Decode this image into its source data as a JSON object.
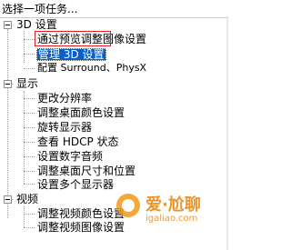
{
  "header": {
    "title": "选择一项任务..."
  },
  "tree": {
    "groups": [
      {
        "label": "3D 设置",
        "items": [
          {
            "label": "通过预览调整图像设置"
          },
          {
            "label": "管理 3D 设置"
          },
          {
            "label": "配置 Surround、PhysX"
          }
        ]
      },
      {
        "label": "显示",
        "items": [
          {
            "label": "更改分辨率"
          },
          {
            "label": "调整桌面颜色设置"
          },
          {
            "label": "旋转显示器"
          },
          {
            "label": "查看 HDCP 状态"
          },
          {
            "label": "设置数字音频"
          },
          {
            "label": "调整桌面尺寸和位置"
          },
          {
            "label": "设置多个显示器"
          }
        ]
      },
      {
        "label": "视频",
        "items": [
          {
            "label": "调整视频颜色设置"
          },
          {
            "label": "调整视频图像设置"
          }
        ]
      }
    ]
  },
  "watermark": {
    "brand": "爱·尬聊",
    "site": "igaliao.com"
  },
  "colors": {
    "selection": "#0a5fc6",
    "highlight_box": "#e02020",
    "watermark": "#e98b16"
  }
}
